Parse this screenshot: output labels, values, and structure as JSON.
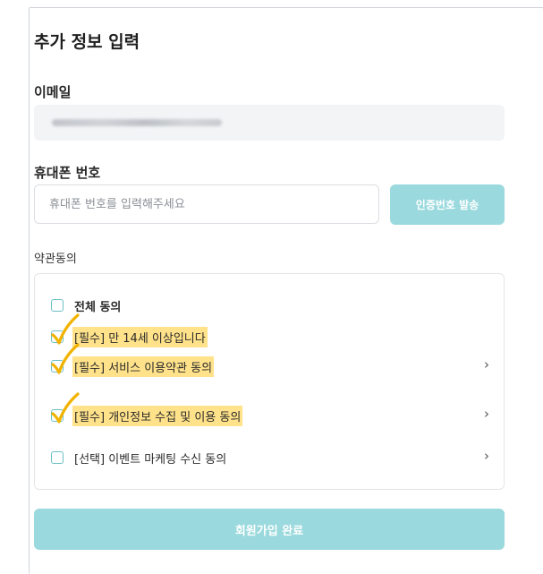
{
  "form": {
    "title": "추가 정보 입력",
    "email": {
      "label": "이메일",
      "value_blurred": true
    },
    "phone": {
      "label": "휴대폰 번호",
      "placeholder": "휴대폰 번호를 입력해주세요",
      "send_button": "인증번호 발송"
    },
    "terms": {
      "label": "약관동의",
      "items": [
        {
          "text": "전체 동의",
          "checked": false,
          "bold": true,
          "highlighted": false,
          "has_arrow": false
        },
        {
          "text": "[필수] 만 14세 이상입니다",
          "checked": true,
          "bold": false,
          "highlighted": true,
          "has_arrow": false
        },
        {
          "text": "[필수] 서비스 이용약관 동의",
          "checked": true,
          "bold": false,
          "highlighted": true,
          "has_arrow": true
        },
        {
          "text": "[필수] 개인정보 수집 및 이용 동의",
          "checked": true,
          "bold": false,
          "highlighted": true,
          "has_arrow": true
        },
        {
          "text": "[선택] 이벤트 마케팅 수신 동의",
          "checked": false,
          "bold": false,
          "highlighted": false,
          "has_arrow": true
        }
      ],
      "arrow_glyph": "›"
    },
    "submit_button": "회원가입 완료"
  },
  "colors": {
    "accent": "#9ad9dd",
    "highlight": "#ffe28a",
    "checkmark": "#f2b300",
    "checkbox_border": "#6bbfc6"
  }
}
